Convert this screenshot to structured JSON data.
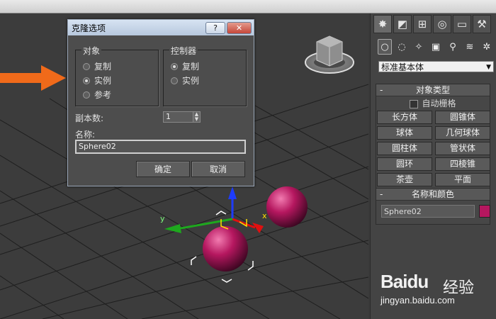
{
  "dialog": {
    "title": "克隆选项",
    "help_label": "?",
    "close_label": "✕",
    "object_group": {
      "label": "对象",
      "options": [
        "复制",
        "实例",
        "参考"
      ],
      "selected": "实例"
    },
    "controller_group": {
      "label": "控制器",
      "options": [
        "复制",
        "实例"
      ],
      "selected": "复制"
    },
    "copies_label": "副本数:",
    "copies_value": "1",
    "name_label": "名称:",
    "name_value": "Sphere02",
    "ok_label": "确定",
    "cancel_label": "取消"
  },
  "command_panel": {
    "tabs": [
      "create-icon",
      "modify-icon",
      "hierarchy-icon",
      "motion-icon",
      "display-icon",
      "utilities-icon"
    ],
    "subtabs": [
      "geometry-icon",
      "shapes-icon",
      "lights-icon",
      "cameras-icon",
      "helpers-icon",
      "spacewarps-icon",
      "systems-icon"
    ],
    "category": "标准基本体",
    "object_type": {
      "header": "对象类型",
      "collapse": "-",
      "autogrid_label": "自动栅格",
      "buttons": [
        "长方体",
        "圆锥体",
        "球体",
        "几何球体",
        "圆柱体",
        "管状体",
        "圆环",
        "四棱锥",
        "茶壶",
        "平面"
      ]
    },
    "name_color": {
      "header": "名称和颜色",
      "collapse": "-",
      "name_value": "Sphere02",
      "color": "#b5175f"
    }
  },
  "viewport": {
    "axis_x": "x",
    "axis_y": "y"
  },
  "watermark": {
    "brand": "Baidu",
    "cn": "经验",
    "url": "jingyan.baidu.com"
  },
  "colors": {
    "accent_arrow": "#f06a1a",
    "sphere": "#b5175f",
    "viewport_bg": "#3c3c3c"
  }
}
